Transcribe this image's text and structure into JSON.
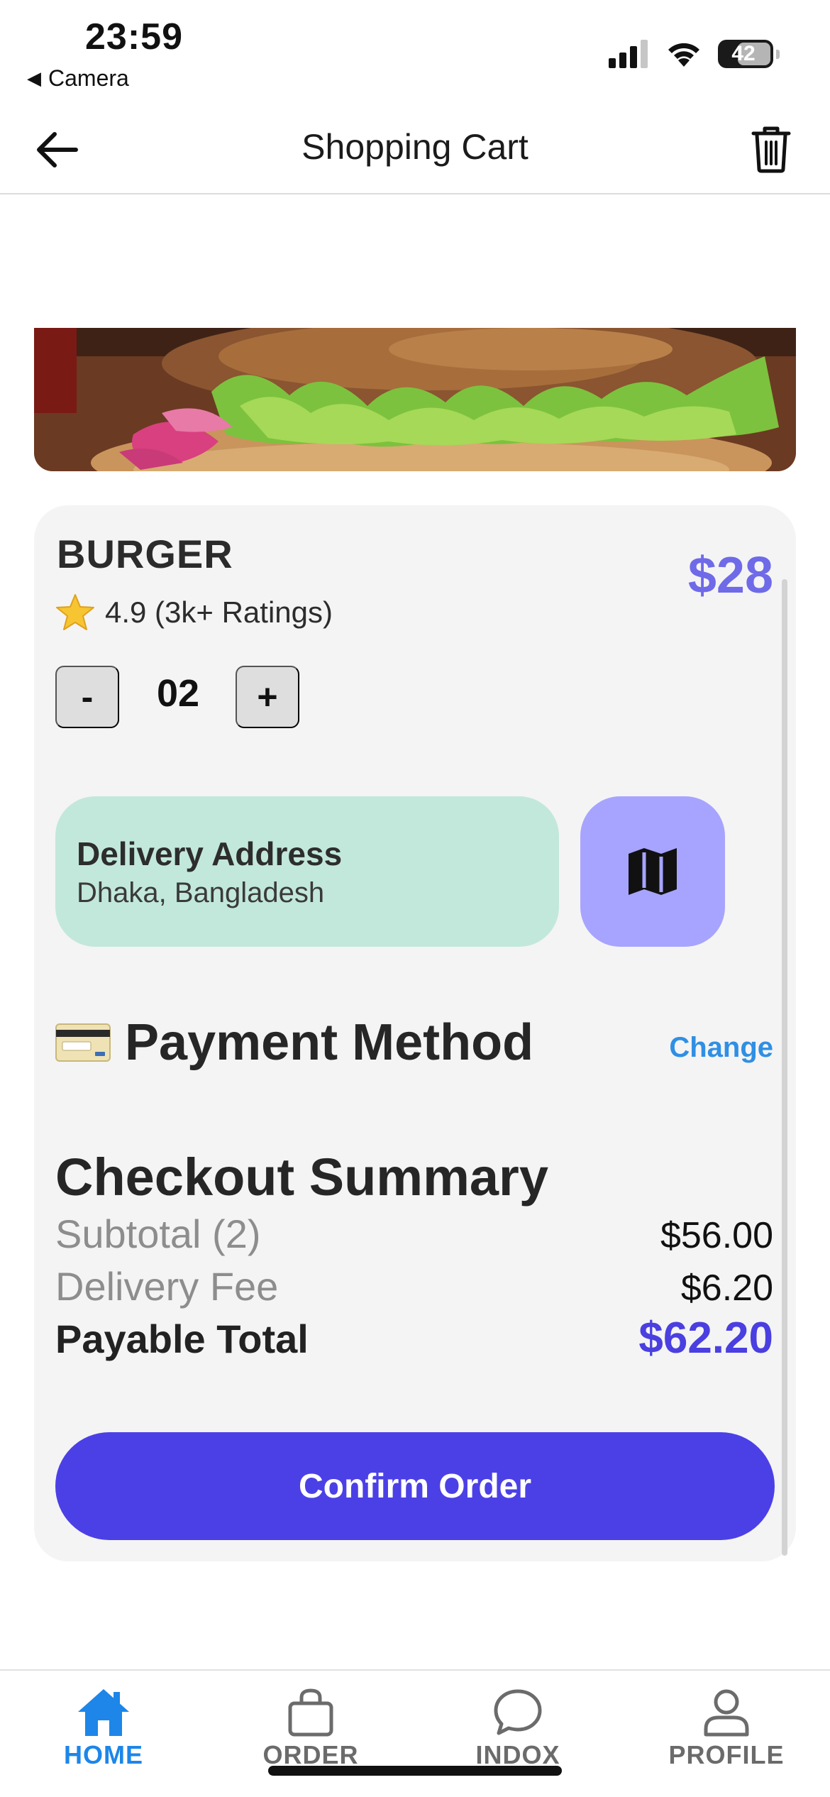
{
  "status_bar": {
    "time": "23:59",
    "back_app": "Camera",
    "battery_level": "42"
  },
  "header": {
    "title": "Shopping Cart"
  },
  "item": {
    "name": "BURGER",
    "price": "$28",
    "rating": "4.9 (3k+ Ratings)",
    "quantity": "02",
    "minus_label": "-",
    "plus_label": "+"
  },
  "delivery": {
    "title": "Delivery Address",
    "address": "Dhaka, Bangladesh"
  },
  "payment": {
    "title": "Payment Method",
    "change_label": "Change"
  },
  "checkout": {
    "title": "Checkout Summary",
    "rows": [
      {
        "label": "Subtotal (2)",
        "value": "$56.00"
      },
      {
        "label": "Delivery Fee",
        "value": "$6.20"
      },
      {
        "label": "Payable Total",
        "value": "$62.20"
      }
    ],
    "confirm_label": "Confirm Order"
  },
  "nav": {
    "items": [
      {
        "label": "HOME",
        "icon": "home-icon",
        "active": true
      },
      {
        "label": "ORDER",
        "icon": "shopping-bag-icon",
        "active": false
      },
      {
        "label": "INDOX",
        "icon": "chat-bubble-icon",
        "active": false
      },
      {
        "label": "PROFILE",
        "icon": "user-icon",
        "active": false
      }
    ]
  },
  "colors": {
    "accent": "#4b40e6",
    "price": "#6f6ae8",
    "address_bg": "#c2e8db",
    "map_button_bg": "#a7a4ff",
    "link": "#2f8fe4",
    "nav_active": "#1d86e8"
  }
}
